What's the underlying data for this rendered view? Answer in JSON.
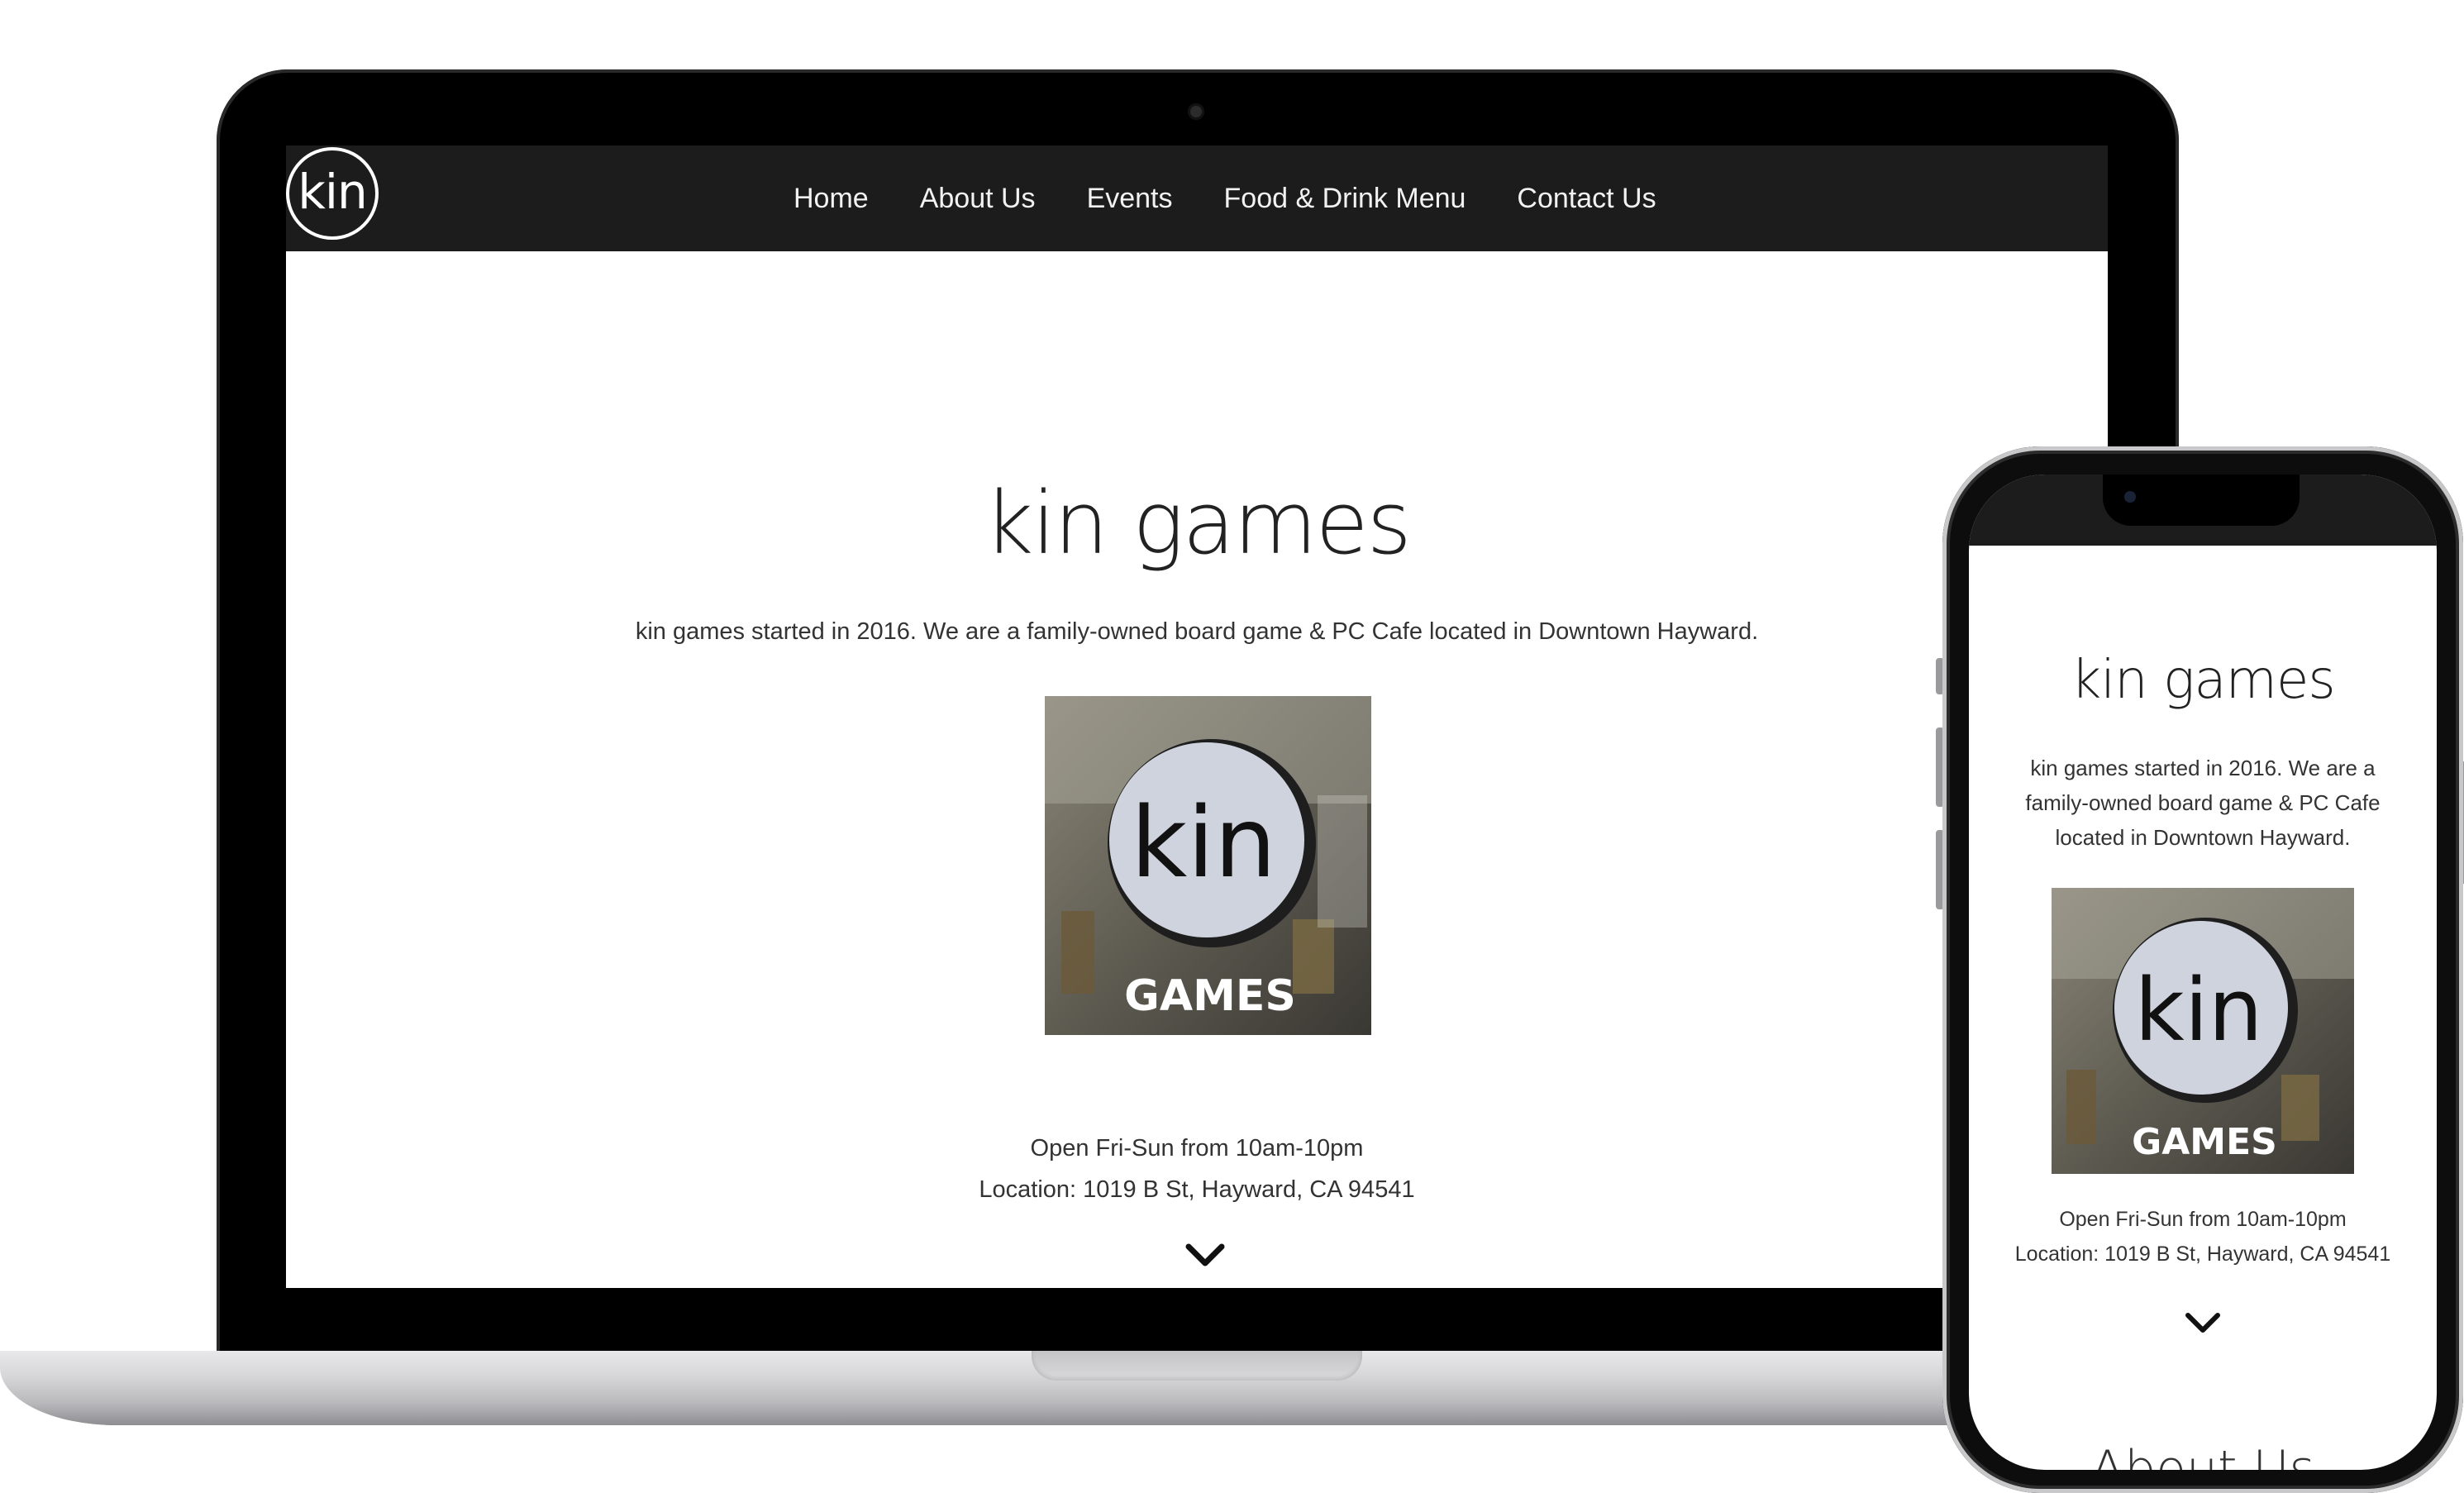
{
  "site": {
    "logo_text": "kin",
    "nav": [
      "Home",
      "About Us",
      "Events",
      "Food & Drink Menu",
      "Contact Us"
    ],
    "title": "kin games",
    "tagline": "kin games started in 2016. We are a family-owned board game & PC Cafe located in Downtown Hayward.",
    "photo": {
      "sign_text": "kin",
      "caption": "GAMES"
    },
    "hours": "Open Fri-Sun from 10am-10pm",
    "location": "Location: 1019 B St, Hayward, CA 94541",
    "next_section_heading": "About Us"
  },
  "icons": {
    "scroll_down": "chevron-down-icon"
  },
  "colors": {
    "nav_bg": "#1b1c1b",
    "text": "#333333",
    "device_frame": "#000000"
  }
}
